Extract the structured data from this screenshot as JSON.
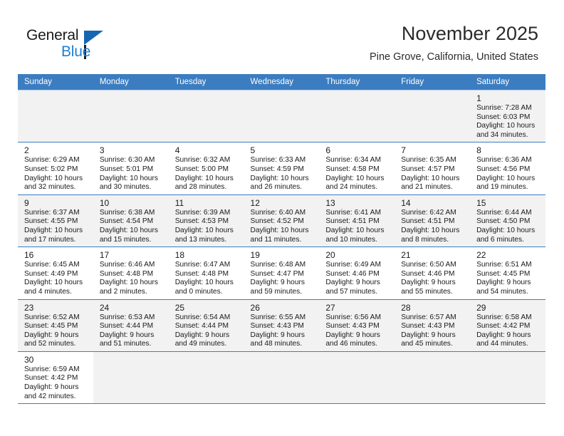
{
  "brand": {
    "name_top": "General",
    "name_bottom": "Blue",
    "accent_color": "#1b7fd4",
    "triangle_color": "#1567b2"
  },
  "header": {
    "title": "November 2025",
    "location": "Pine Grove, California, United States"
  },
  "calendar": {
    "header_bg": "#3b7dc0",
    "shade_bg": "#f2f2f2",
    "weekday_labels": [
      "Sunday",
      "Monday",
      "Tuesday",
      "Wednesday",
      "Thursday",
      "Friday",
      "Saturday"
    ],
    "weeks": [
      [
        {
          "empty": true
        },
        {
          "empty": true
        },
        {
          "empty": true
        },
        {
          "empty": true
        },
        {
          "empty": true
        },
        {
          "empty": true
        },
        {
          "day": "1",
          "sunrise": "Sunrise: 7:28 AM",
          "sunset": "Sunset: 6:03 PM",
          "daylight1": "Daylight: 10 hours",
          "daylight2": "and 34 minutes."
        }
      ],
      [
        {
          "day": "2",
          "sunrise": "Sunrise: 6:29 AM",
          "sunset": "Sunset: 5:02 PM",
          "daylight1": "Daylight: 10 hours",
          "daylight2": "and 32 minutes."
        },
        {
          "day": "3",
          "sunrise": "Sunrise: 6:30 AM",
          "sunset": "Sunset: 5:01 PM",
          "daylight1": "Daylight: 10 hours",
          "daylight2": "and 30 minutes."
        },
        {
          "day": "4",
          "sunrise": "Sunrise: 6:32 AM",
          "sunset": "Sunset: 5:00 PM",
          "daylight1": "Daylight: 10 hours",
          "daylight2": "and 28 minutes."
        },
        {
          "day": "5",
          "sunrise": "Sunrise: 6:33 AM",
          "sunset": "Sunset: 4:59 PM",
          "daylight1": "Daylight: 10 hours",
          "daylight2": "and 26 minutes."
        },
        {
          "day": "6",
          "sunrise": "Sunrise: 6:34 AM",
          "sunset": "Sunset: 4:58 PM",
          "daylight1": "Daylight: 10 hours",
          "daylight2": "and 24 minutes."
        },
        {
          "day": "7",
          "sunrise": "Sunrise: 6:35 AM",
          "sunset": "Sunset: 4:57 PM",
          "daylight1": "Daylight: 10 hours",
          "daylight2": "and 21 minutes."
        },
        {
          "day": "8",
          "sunrise": "Sunrise: 6:36 AM",
          "sunset": "Sunset: 4:56 PM",
          "daylight1": "Daylight: 10 hours",
          "daylight2": "and 19 minutes."
        }
      ],
      [
        {
          "day": "9",
          "sunrise": "Sunrise: 6:37 AM",
          "sunset": "Sunset: 4:55 PM",
          "daylight1": "Daylight: 10 hours",
          "daylight2": "and 17 minutes."
        },
        {
          "day": "10",
          "sunrise": "Sunrise: 6:38 AM",
          "sunset": "Sunset: 4:54 PM",
          "daylight1": "Daylight: 10 hours",
          "daylight2": "and 15 minutes."
        },
        {
          "day": "11",
          "sunrise": "Sunrise: 6:39 AM",
          "sunset": "Sunset: 4:53 PM",
          "daylight1": "Daylight: 10 hours",
          "daylight2": "and 13 minutes."
        },
        {
          "day": "12",
          "sunrise": "Sunrise: 6:40 AM",
          "sunset": "Sunset: 4:52 PM",
          "daylight1": "Daylight: 10 hours",
          "daylight2": "and 11 minutes."
        },
        {
          "day": "13",
          "sunrise": "Sunrise: 6:41 AM",
          "sunset": "Sunset: 4:51 PM",
          "daylight1": "Daylight: 10 hours",
          "daylight2": "and 10 minutes."
        },
        {
          "day": "14",
          "sunrise": "Sunrise: 6:42 AM",
          "sunset": "Sunset: 4:51 PM",
          "daylight1": "Daylight: 10 hours",
          "daylight2": "and 8 minutes."
        },
        {
          "day": "15",
          "sunrise": "Sunrise: 6:44 AM",
          "sunset": "Sunset: 4:50 PM",
          "daylight1": "Daylight: 10 hours",
          "daylight2": "and 6 minutes."
        }
      ],
      [
        {
          "day": "16",
          "sunrise": "Sunrise: 6:45 AM",
          "sunset": "Sunset: 4:49 PM",
          "daylight1": "Daylight: 10 hours",
          "daylight2": "and 4 minutes."
        },
        {
          "day": "17",
          "sunrise": "Sunrise: 6:46 AM",
          "sunset": "Sunset: 4:48 PM",
          "daylight1": "Daylight: 10 hours",
          "daylight2": "and 2 minutes."
        },
        {
          "day": "18",
          "sunrise": "Sunrise: 6:47 AM",
          "sunset": "Sunset: 4:48 PM",
          "daylight1": "Daylight: 10 hours",
          "daylight2": "and 0 minutes."
        },
        {
          "day": "19",
          "sunrise": "Sunrise: 6:48 AM",
          "sunset": "Sunset: 4:47 PM",
          "daylight1": "Daylight: 9 hours",
          "daylight2": "and 59 minutes."
        },
        {
          "day": "20",
          "sunrise": "Sunrise: 6:49 AM",
          "sunset": "Sunset: 4:46 PM",
          "daylight1": "Daylight: 9 hours",
          "daylight2": "and 57 minutes."
        },
        {
          "day": "21",
          "sunrise": "Sunrise: 6:50 AM",
          "sunset": "Sunset: 4:46 PM",
          "daylight1": "Daylight: 9 hours",
          "daylight2": "and 55 minutes."
        },
        {
          "day": "22",
          "sunrise": "Sunrise: 6:51 AM",
          "sunset": "Sunset: 4:45 PM",
          "daylight1": "Daylight: 9 hours",
          "daylight2": "and 54 minutes."
        }
      ],
      [
        {
          "day": "23",
          "sunrise": "Sunrise: 6:52 AM",
          "sunset": "Sunset: 4:45 PM",
          "daylight1": "Daylight: 9 hours",
          "daylight2": "and 52 minutes."
        },
        {
          "day": "24",
          "sunrise": "Sunrise: 6:53 AM",
          "sunset": "Sunset: 4:44 PM",
          "daylight1": "Daylight: 9 hours",
          "daylight2": "and 51 minutes."
        },
        {
          "day": "25",
          "sunrise": "Sunrise: 6:54 AM",
          "sunset": "Sunset: 4:44 PM",
          "daylight1": "Daylight: 9 hours",
          "daylight2": "and 49 minutes."
        },
        {
          "day": "26",
          "sunrise": "Sunrise: 6:55 AM",
          "sunset": "Sunset: 4:43 PM",
          "daylight1": "Daylight: 9 hours",
          "daylight2": "and 48 minutes."
        },
        {
          "day": "27",
          "sunrise": "Sunrise: 6:56 AM",
          "sunset": "Sunset: 4:43 PM",
          "daylight1": "Daylight: 9 hours",
          "daylight2": "and 46 minutes."
        },
        {
          "day": "28",
          "sunrise": "Sunrise: 6:57 AM",
          "sunset": "Sunset: 4:43 PM",
          "daylight1": "Daylight: 9 hours",
          "daylight2": "and 45 minutes."
        },
        {
          "day": "29",
          "sunrise": "Sunrise: 6:58 AM",
          "sunset": "Sunset: 4:42 PM",
          "daylight1": "Daylight: 9 hours",
          "daylight2": "and 44 minutes."
        }
      ],
      [
        {
          "day": "30",
          "sunrise": "Sunrise: 6:59 AM",
          "sunset": "Sunset: 4:42 PM",
          "daylight1": "Daylight: 9 hours",
          "daylight2": "and 42 minutes."
        },
        {
          "empty": true
        },
        {
          "empty": true
        },
        {
          "empty": true
        },
        {
          "empty": true
        },
        {
          "empty": true
        },
        {
          "empty": true
        }
      ]
    ]
  }
}
